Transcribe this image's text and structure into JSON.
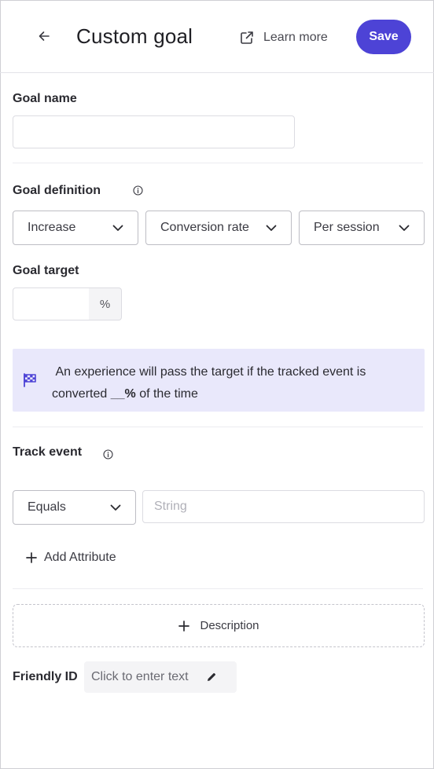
{
  "header": {
    "title": "Custom goal",
    "learn_more": "Learn more",
    "save_label": "Save"
  },
  "goal_name": {
    "label": "Goal name",
    "value": "",
    "placeholder": ""
  },
  "goal_definition": {
    "label": "Goal definition",
    "direction": "Increase",
    "metric": "Conversion rate",
    "scope": "Per session"
  },
  "goal_target": {
    "label": "Goal target",
    "value": "",
    "unit": "%"
  },
  "banner": {
    "text_before": "An experience will pass the target if the tracked event is converted ",
    "highlight": "__%",
    "text_after": " of the time"
  },
  "track_event": {
    "label": "Track event",
    "operator": "Equals",
    "value_placeholder": "String",
    "add_attribute": "Add Attribute"
  },
  "description": {
    "label": "Description"
  },
  "friendly_id": {
    "label": "Friendly ID",
    "placeholder": "Click to enter text"
  },
  "colors": {
    "accent": "#4d43d6",
    "banner_bg": "#e9e8fb"
  },
  "icons": {
    "back": "arrow-left-icon",
    "external": "external-link-icon",
    "info": "info-icon",
    "chevron": "chevron-down-icon",
    "flag": "flag-icon",
    "plus": "plus-icon",
    "edit": "pencil-icon"
  }
}
